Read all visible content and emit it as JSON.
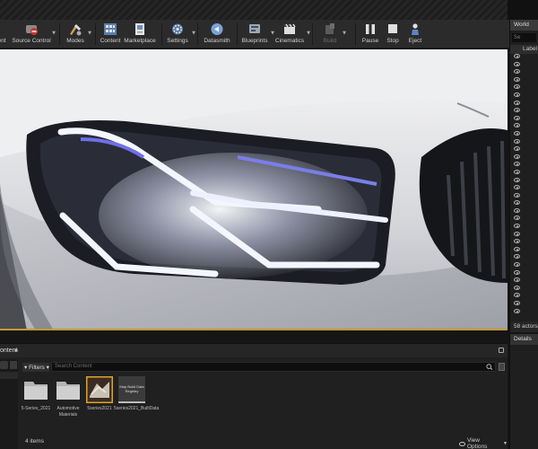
{
  "toolbar": {
    "items": [
      {
        "label": "ent"
      },
      {
        "label": "Source Control"
      },
      {
        "label": "Modes"
      },
      {
        "label": "Content"
      },
      {
        "label": "Marketplace"
      },
      {
        "label": "Settings"
      },
      {
        "label": "Datasmith"
      },
      {
        "label": "Blueprints"
      },
      {
        "label": "Cinematics"
      },
      {
        "label": "Build"
      },
      {
        "label": "Pause"
      },
      {
        "label": "Stop"
      },
      {
        "label": "Eject"
      }
    ]
  },
  "outliner": {
    "tab_label": "World",
    "search_placeholder": "Se",
    "column_label": "Label",
    "actor_count": "58 actors"
  },
  "details": {
    "tab_label": "Details"
  },
  "content_browser": {
    "tab_label": "ontent",
    "filters_label": "Filters",
    "search_placeholder": "Search Content",
    "assets": [
      {
        "name": "5-Series_2021"
      },
      {
        "name": "Automotive Materials"
      },
      {
        "name": "5series2021"
      },
      {
        "name": "5series2021_BuiltData",
        "thumb_text": "Map Build Data Registry"
      }
    ],
    "item_count": "4 items",
    "view_options_label": "View Options"
  },
  "colors": {
    "accent_orange": "#c49a2c",
    "panel_dark": "#1f1f1f",
    "toolbar_bg": "#2b2b2b"
  }
}
